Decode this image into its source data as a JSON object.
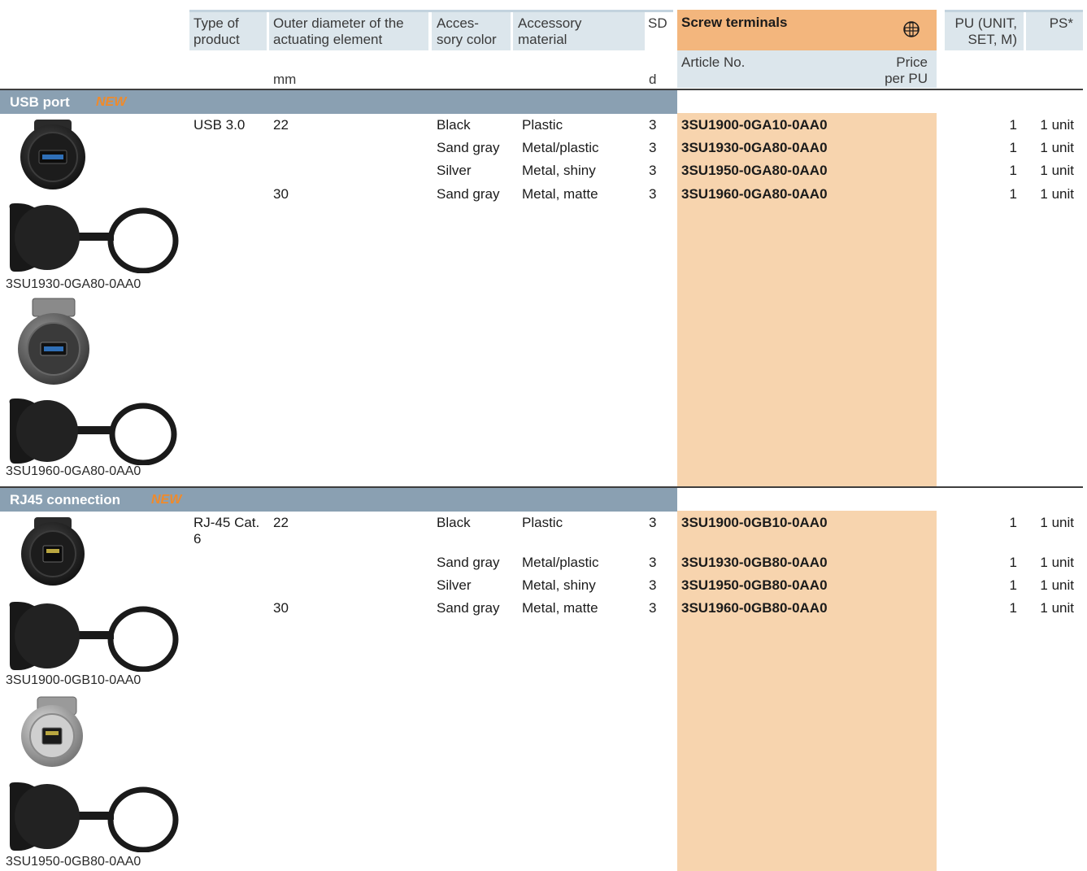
{
  "header": {
    "type_of_product": [
      "Type of",
      "product"
    ],
    "outer_diameter": [
      "Outer diameter of the",
      "actuating element"
    ],
    "outer_diameter_unit": "mm",
    "accessory_color": [
      "Acces-",
      "sory color"
    ],
    "accessory_material": [
      "Accessory",
      "material"
    ],
    "sd": "SD",
    "sd_unit": "d",
    "screw_terminals": "Screw terminals",
    "article_no": "Article No.",
    "price": [
      "Price",
      "per PU"
    ],
    "pu": [
      "PU (UNIT,",
      "SET, M)"
    ],
    "ps": "PS*"
  },
  "sections": [
    {
      "title": "USB port",
      "badge": "NEW",
      "rows": [
        {
          "type": "USB 3.0",
          "diameter": "22",
          "color": "Black",
          "material": "Plastic",
          "sd": "3",
          "article": "3SU1900-0GA10-0AA0",
          "pu": "1",
          "ps": "1 unit"
        },
        {
          "type": "",
          "diameter": "",
          "color": "Sand gray",
          "material": "Metal/plastic",
          "sd": "3",
          "article": "3SU1930-0GA80-0AA0",
          "pu": "1",
          "ps": "1 unit"
        },
        {
          "type": "",
          "diameter": "",
          "color": "Silver",
          "material": "Metal, shiny",
          "sd": "3",
          "article": "3SU1950-0GA80-0AA0",
          "pu": "1",
          "ps": "1 unit"
        },
        {
          "type": "",
          "diameter": "30",
          "color": "Sand gray",
          "material": "Metal, matte",
          "sd": "3",
          "article": "3SU1960-0GA80-0AA0",
          "pu": "1",
          "ps": "1 unit"
        }
      ],
      "captions": [
        "3SU1930-0GA80-0AA0",
        "3SU1960-0GA80-0AA0"
      ]
    },
    {
      "title": "RJ45 connection",
      "badge": "NEW",
      "rows": [
        {
          "type": "RJ-45 Cat.",
          "type2": "6",
          "diameter": "22",
          "color": "Black",
          "material": "Plastic",
          "sd": "3",
          "article": "3SU1900-0GB10-0AA0",
          "pu": "1",
          "ps": "1 unit"
        },
        {
          "type": "",
          "diameter": "",
          "color": "Sand gray",
          "material": "Metal/plastic",
          "sd": "3",
          "article": "3SU1930-0GB80-0AA0",
          "pu": "1",
          "ps": "1 unit"
        },
        {
          "type": "",
          "diameter": "",
          "color": "Silver",
          "material": "Metal, shiny",
          "sd": "3",
          "article": "3SU1950-0GB80-0AA0",
          "pu": "1",
          "ps": "1 unit"
        },
        {
          "type": "",
          "diameter": "30",
          "color": "Sand gray",
          "material": "Metal, matte",
          "sd": "3",
          "article": "3SU1960-0GB80-0AA0",
          "pu": "1",
          "ps": "1 unit"
        }
      ],
      "captions": [
        "3SU1900-0GB10-0AA0",
        "3SU1950-0GB80-0AA0"
      ]
    }
  ],
  "icons": {
    "screw_terminal": "screw-terminal-icon"
  },
  "colors": {
    "section_bar": "#8aa0b2",
    "orange_column": "#f7d4ae",
    "orange_header": "#f3b67d",
    "header_bg": "#dce6ec",
    "new_badge": "#f08a2a"
  }
}
